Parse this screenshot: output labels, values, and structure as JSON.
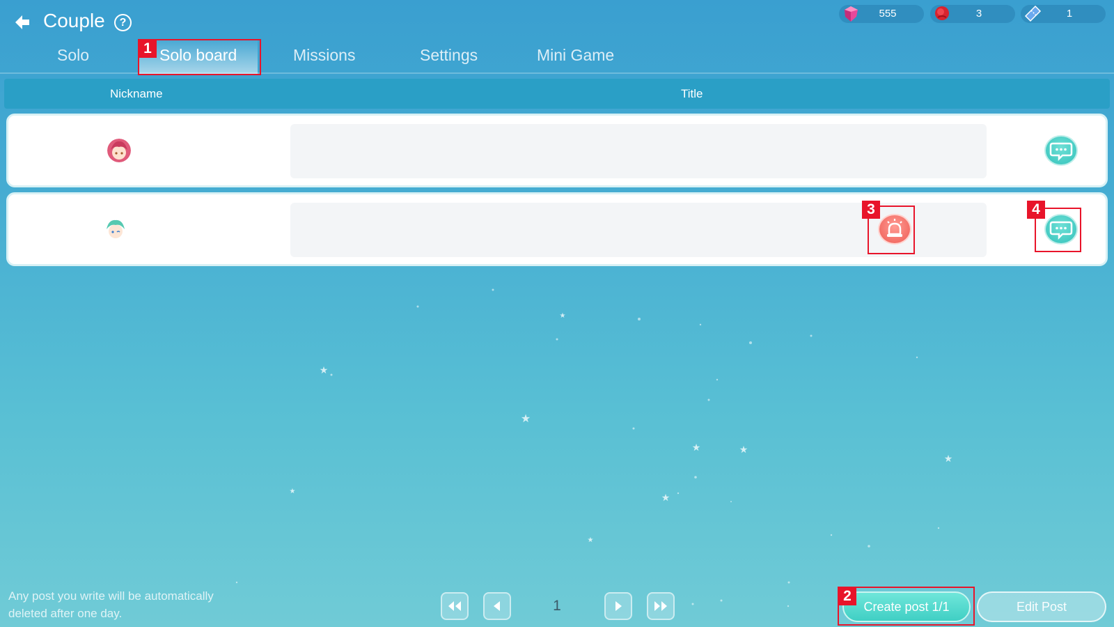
{
  "header": {
    "title": "Couple",
    "back_icon": "arrow-left-icon",
    "help_label": "?"
  },
  "currencies": [
    {
      "icon": "pink-gem-icon",
      "value": "555"
    },
    {
      "icon": "rose-icon",
      "value": "3"
    },
    {
      "icon": "blue-ticket-icon",
      "value": "1"
    }
  ],
  "tabs": [
    {
      "label": "Solo",
      "active": false
    },
    {
      "label": "Solo board",
      "active": true
    },
    {
      "label": "Missions",
      "active": false
    },
    {
      "label": "Settings",
      "active": false
    },
    {
      "label": "Mini Game",
      "active": false
    }
  ],
  "table": {
    "columns": [
      "Nickname",
      "Title"
    ],
    "rows": [
      {
        "avatar": "pink-hair-avatar",
        "title": "",
        "actions": [
          "comment"
        ]
      },
      {
        "avatar": "green-hair-avatar",
        "title": "",
        "actions": [
          "report",
          "comment"
        ]
      }
    ]
  },
  "footer": {
    "notice": "Any post you write will be automatically deleted after one day.",
    "page": "1",
    "create_label": "Create post 1/1",
    "edit_label": "Edit Post"
  },
  "annotations": [
    "1",
    "2",
    "3",
    "4"
  ],
  "colors": {
    "accent_teal": "#45cbc3",
    "report_red": "#f36f67",
    "annotation_red": "#e8142a",
    "header_bar": "#2a9fc6"
  }
}
